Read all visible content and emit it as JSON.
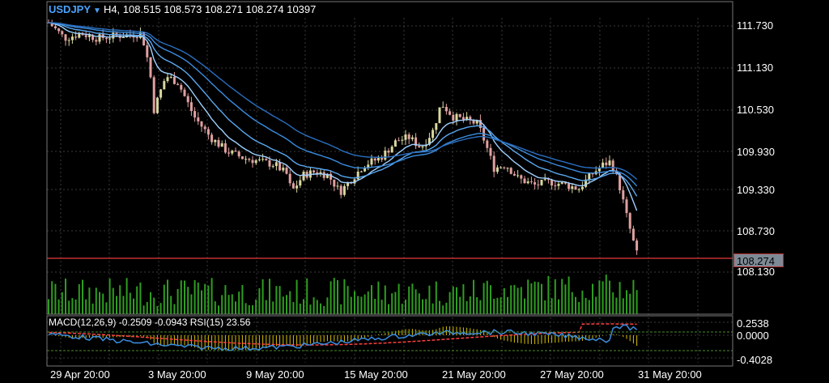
{
  "header": {
    "symbol": "USDJPY",
    "arrow": "▼",
    "timeframe": "H4,",
    "ohlcv": "108.515 108.573 108.271 108.274 10397"
  },
  "price_axis": [
    "111.730",
    "111.130",
    "110.530",
    "109.930",
    "109.330",
    "108.730",
    "108.130"
  ],
  "current_price": "108.274",
  "indicator_header": "MACD(12,26,9) -0.2509 -0.0943 RSI(15) 23.56",
  "indicator_axis": [
    "0.2538",
    "0.0000",
    "-0.4028"
  ],
  "date_axis": [
    "29 Apr 20:00",
    "3 May 20:00",
    "9 May 20:00",
    "15 May 20:00",
    "21 May 20:00",
    "27 May 20:00",
    "31 May 20:00"
  ],
  "colors": {
    "background": "#000000",
    "symbol": "#4aa3ff",
    "bull": "#d8d8a0",
    "bear": "#e0a0a0",
    "ma": "#3a8de0",
    "volume": "#2e9e20",
    "price_line": "#c03030",
    "macd_hist": "#d8c000",
    "macd_signal": "#ff4040",
    "macd_line": "#3a8de0"
  }
}
